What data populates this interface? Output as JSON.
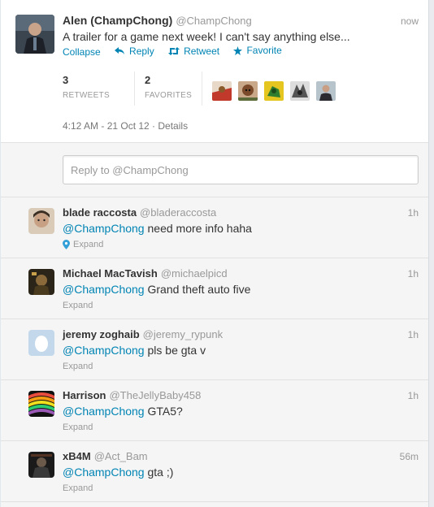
{
  "main_tweet": {
    "name": "Alen (ChampChong)",
    "handle": "@ChampChong",
    "time": "now",
    "text": "A trailer for a game next week! I can't say anything else...",
    "actions": {
      "collapse": "Collapse",
      "reply": "Reply",
      "retweet": "Retweet",
      "favorite": "Favorite"
    },
    "stats": {
      "retweets_count": "3",
      "retweets_label": "RETWEETS",
      "favorites_count": "2",
      "favorites_label": "FAVORITES"
    },
    "meta": "4:12 AM - 21 Oct 12 · Details"
  },
  "reply_box": {
    "placeholder": "Reply to @ChampChong"
  },
  "replies": [
    {
      "name": "blade raccosta",
      "handle": "@bladeraccosta",
      "time": "1h",
      "mention": "@ChampChong",
      "text": " need more info haha",
      "expand": "Expand",
      "has_location": true
    },
    {
      "name": "Michael MacTavish",
      "handle": "@michaelpicd",
      "time": "1h",
      "mention": "@ChampChong",
      "text": " Grand theft auto five",
      "expand": "Expand",
      "has_location": false
    },
    {
      "name": "jeremy zoghaib",
      "handle": "@jeremy_rypunk",
      "time": "1h",
      "mention": "@ChampChong",
      "text": " pls be gta v",
      "expand": "Expand",
      "has_location": false
    },
    {
      "name": "Harrison",
      "handle": "@TheJellyBaby458",
      "time": "1h",
      "mention": "@ChampChong",
      "text": " GTA5?",
      "expand": "Expand",
      "has_location": false
    },
    {
      "name": "xB4M",
      "handle": "@Act_Bam",
      "time": "56m",
      "mention": "@ChampChong",
      "text": " gta ;)",
      "expand": "Expand",
      "has_location": false
    }
  ],
  "colors": {
    "link": "#0084b4",
    "muted": "#999999",
    "text": "#333333"
  }
}
